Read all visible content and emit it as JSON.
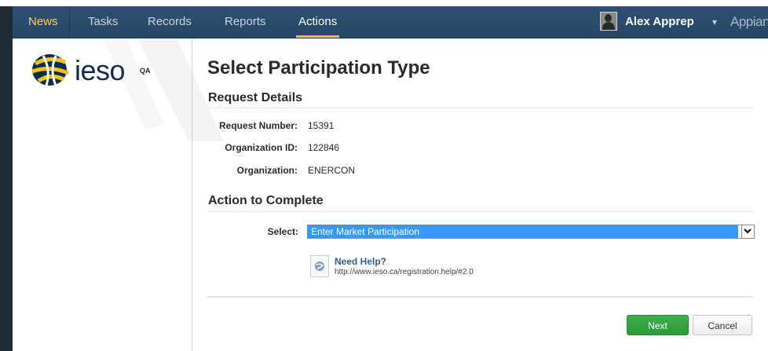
{
  "nav": {
    "items": [
      {
        "label": "News"
      },
      {
        "label": "Tasks"
      },
      {
        "label": "Records"
      },
      {
        "label": "Reports"
      },
      {
        "label": "Actions"
      }
    ],
    "user_name": "Alex Apprep",
    "user_caret": "▾",
    "brand": "Appian"
  },
  "sidebar": {
    "logo_text": "ieso",
    "logo_tag": "QA"
  },
  "page": {
    "title": "Select Participation Type"
  },
  "request_details": {
    "heading": "Request Details",
    "fields": [
      {
        "label": "Request Number:",
        "value": "15391"
      },
      {
        "label": "Organization ID:",
        "value": "122846"
      },
      {
        "label": "Organization:",
        "value": "ENERCON"
      }
    ]
  },
  "action": {
    "heading": "Action to Complete",
    "select_label": "Select:",
    "select_value": "Enter Market Participation"
  },
  "help": {
    "title": "Need Help?",
    "url": "http://www.ieso.ca/registration.help/#2.0"
  },
  "buttons": {
    "next": "Next",
    "cancel": "Cancel"
  },
  "colors": {
    "nav_bg": "#2d5073",
    "nav_active": "#ffd23f",
    "accent_green": "#2b9a39",
    "select_highlight": "#3399ff",
    "link": "#2f5e9a"
  }
}
